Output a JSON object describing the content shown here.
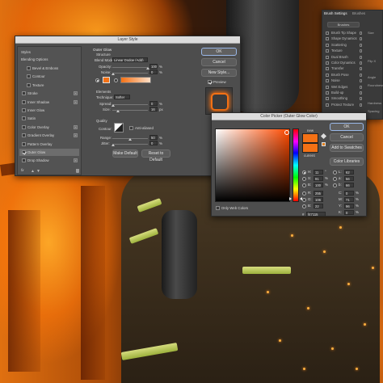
{
  "layer_style": {
    "title": "Layer Style",
    "styles_header": "Styles",
    "blending_options": "Blending Options",
    "items": [
      {
        "label": "Bevel & Emboss",
        "checked": false,
        "plus": false
      },
      {
        "label": "Contour",
        "checked": false,
        "plus": false
      },
      {
        "label": "Texture",
        "checked": false,
        "plus": false
      },
      {
        "label": "Stroke",
        "checked": false,
        "plus": true
      },
      {
        "label": "Inner Shadow",
        "checked": false,
        "plus": true
      },
      {
        "label": "Inner Glow",
        "checked": false,
        "plus": false
      },
      {
        "label": "Satin",
        "checked": false,
        "plus": false
      },
      {
        "label": "Color Overlay",
        "checked": false,
        "plus": true
      },
      {
        "label": "Gradient Overlay",
        "checked": false,
        "plus": true
      },
      {
        "label": "Pattern Overlay",
        "checked": false,
        "plus": false
      },
      {
        "label": "Outer Glow",
        "checked": true,
        "plus": false,
        "selected": true
      },
      {
        "label": "Drop Shadow",
        "checked": false,
        "plus": true
      }
    ],
    "fx_label": "fx",
    "outer_glow_title": "Outer Glow",
    "structure_title": "Structure",
    "blend_mode_label": "Blend Mode:",
    "blend_mode_value": "Linear Dodge (Add)",
    "opacity_label": "Opacity:",
    "opacity_value": "100",
    "noise_label": "Noise:",
    "noise_value": "0",
    "percent": "%",
    "px": "px",
    "elements_title": "Elements",
    "technique_label": "Technique:",
    "technique_value": "Softer",
    "spread_label": "Spread:",
    "spread_value": "0",
    "size_label": "Size:",
    "size_value": "16",
    "quality_title": "Quality",
    "contour_label": "Contour:",
    "antialiased_label": "Anti-aliased",
    "range_label": "Range:",
    "range_value": "50",
    "jitter_label": "Jitter:",
    "jitter_value": "0",
    "make_default": "Make Default",
    "reset_default": "Reset to Default",
    "ok": "OK",
    "cancel": "Cancel",
    "new_style": "New Style...",
    "preview_label": "Preview",
    "preview_checked": true,
    "glow_color": "#f47115"
  },
  "color_picker": {
    "title": "Color Picker (Outer Glow Color)",
    "ok": "OK",
    "cancel": "Cancel",
    "add_swatches": "Add to Swatches",
    "color_libraries": "Color Libraries",
    "new_label": "new",
    "current_label": "current",
    "new_color": "#f47115",
    "current_color": "#f47115",
    "only_web_colors": "Only Web Colors",
    "hex_label": "#",
    "hex_value": "f47115",
    "fields_left": [
      {
        "label": "H:",
        "value": "11",
        "unit": "°",
        "radio": true
      },
      {
        "label": "S:",
        "value": "91",
        "unit": "%",
        "radio": false
      },
      {
        "label": "B:",
        "value": "100",
        "unit": "%",
        "radio": false
      },
      {
        "label": "R:",
        "value": "255",
        "unit": "",
        "radio": false
      },
      {
        "label": "G:",
        "value": "106",
        "unit": "",
        "radio": false
      },
      {
        "label": "B:",
        "value": "22",
        "unit": "",
        "radio": false
      }
    ],
    "fields_right": [
      {
        "label": "L:",
        "value": "62",
        "unit": ""
      },
      {
        "label": "a:",
        "value": "56",
        "unit": ""
      },
      {
        "label": "b:",
        "value": "66",
        "unit": ""
      },
      {
        "label": "C:",
        "value": "0",
        "unit": "%"
      },
      {
        "label": "M:",
        "value": "71",
        "unit": "%"
      },
      {
        "label": "Y:",
        "value": "96",
        "unit": "%"
      },
      {
        "label": "K:",
        "value": "0",
        "unit": "%"
      }
    ]
  },
  "brush_panel": {
    "tabs": [
      "Brush Settings",
      "Brushes"
    ],
    "brushes_button": "Brushes",
    "items": [
      "Brush Tip Shape",
      "Shape Dynamics",
      "Scattering",
      "Texture",
      "Dual Brush",
      "Color Dynamics",
      "Transfer",
      "Brush Pose",
      "Noise",
      "Wet Edges",
      "Build-up",
      "Smoothing",
      "Protect Texture"
    ],
    "side_labels": [
      "Size",
      "Flip X",
      "Angle",
      "Roundness",
      "Hardness",
      "Spacing"
    ]
  }
}
